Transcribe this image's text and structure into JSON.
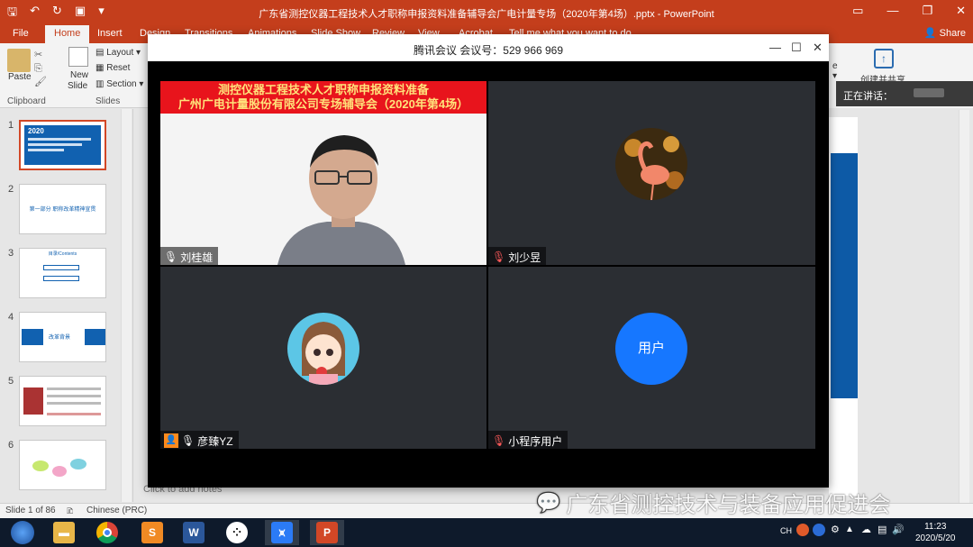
{
  "powerpoint": {
    "doc_title": "广东省测控仪器工程技术人才职称申报资料准备辅导会广电计量专场（2020年第4场）.pptx - PowerPoint",
    "tabs": [
      "File",
      "Home",
      "Insert",
      "Design",
      "Transitions",
      "Animations",
      "Slide Show",
      "Review",
      "View",
      "Acrobat",
      "Tell me what you want to do"
    ],
    "active_tab": "Home",
    "share_label": "Share",
    "ribbon": {
      "paste": "Paste",
      "new_slide": "New",
      "new_slide2": "Slide",
      "layout": "Layout",
      "reset": "Reset",
      "section": "Section",
      "clipboard_group": "Clipboard",
      "slides_group": "Slides",
      "create_share": "创建并共享"
    },
    "slide_numbers": [
      "1",
      "2",
      "3",
      "4",
      "5",
      "6"
    ],
    "thumb2_text": "第一部分 职称改革精神宣贯",
    "thumb3_text": "目录/Contents",
    "thumb4_text": "改革背景",
    "thumb1_year": "2020",
    "notes_placeholder": "Click to add notes",
    "status_slide": "Slide 1 of 86",
    "status_lang": "Chinese (PRC)"
  },
  "meeting": {
    "title": "腾讯会议 会议号：529 966 969",
    "speaking_label": "正在讲话：",
    "banner_line1": "测控仪器工程技术人才职称申报资料准备",
    "banner_line2": "广州广电计量股份有限公司专场辅导会（2020年第4场）",
    "participants": [
      {
        "name": "刘桂雄"
      },
      {
        "name": "刘少昱"
      },
      {
        "name": "彦臻YZ"
      },
      {
        "name": "小程序用户",
        "avatar_text": "用户"
      }
    ],
    "colors": {
      "user_avatar": "#1677ff",
      "tile_bg": "#2b2e33",
      "banner": "#e8141c"
    }
  },
  "watermark": "广东省测控技术与装备应用促进会",
  "taskbar": {
    "lang": "CH",
    "time": "11:23",
    "date": "2020/5/20"
  }
}
